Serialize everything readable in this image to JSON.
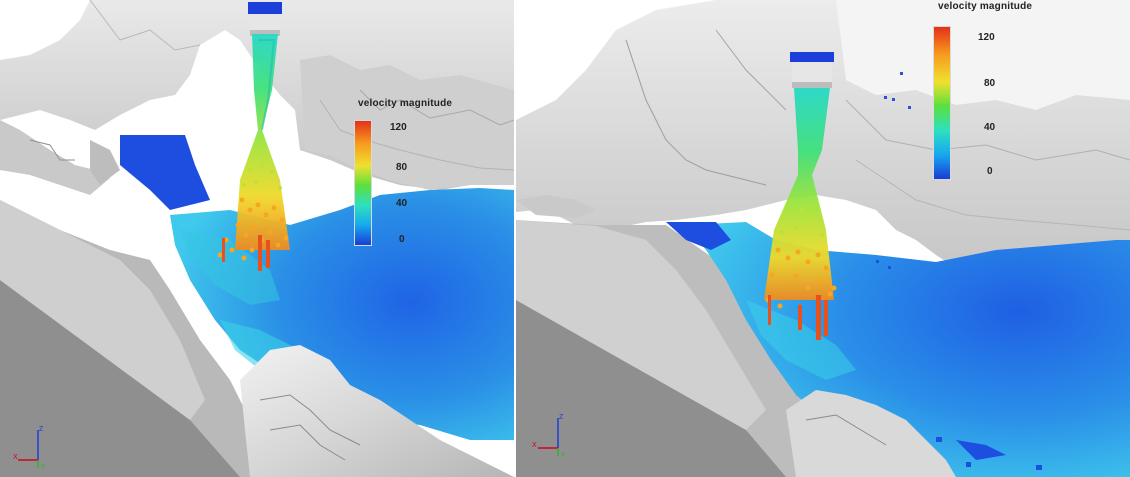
{
  "colors": {
    "background": "#ffffff",
    "rock": "#dcdcdc",
    "rock_shadow": "#9a9a9a",
    "ground": "#a9a9a9",
    "water_deep": "#1e5fe0",
    "water_light": "#36bde8"
  },
  "colorbar_gradient": [
    "#1a3dd6",
    "#17a8ee",
    "#2ee0c0",
    "#5be03c",
    "#f0e030",
    "#f79a1e",
    "#e5301a"
  ],
  "panels": [
    {
      "legend": {
        "title": "velocity magnitude",
        "ticks": [
          "120",
          "80",
          "40",
          "0"
        ],
        "max": 120,
        "min": 0
      },
      "axes": {
        "x_label": "X",
        "y_label": "Y",
        "z_label": "Z",
        "icon": "xyz-axes-triad-icon"
      }
    },
    {
      "legend": {
        "title": "velocity magnitude",
        "ticks": [
          "120",
          "80",
          "40",
          "0"
        ],
        "max": 120,
        "min": 0
      },
      "axes": {
        "x_label": "X",
        "y_label": "Y",
        "z_label": "Z",
        "icon": "xyz-axes-triad-icon"
      }
    }
  ]
}
